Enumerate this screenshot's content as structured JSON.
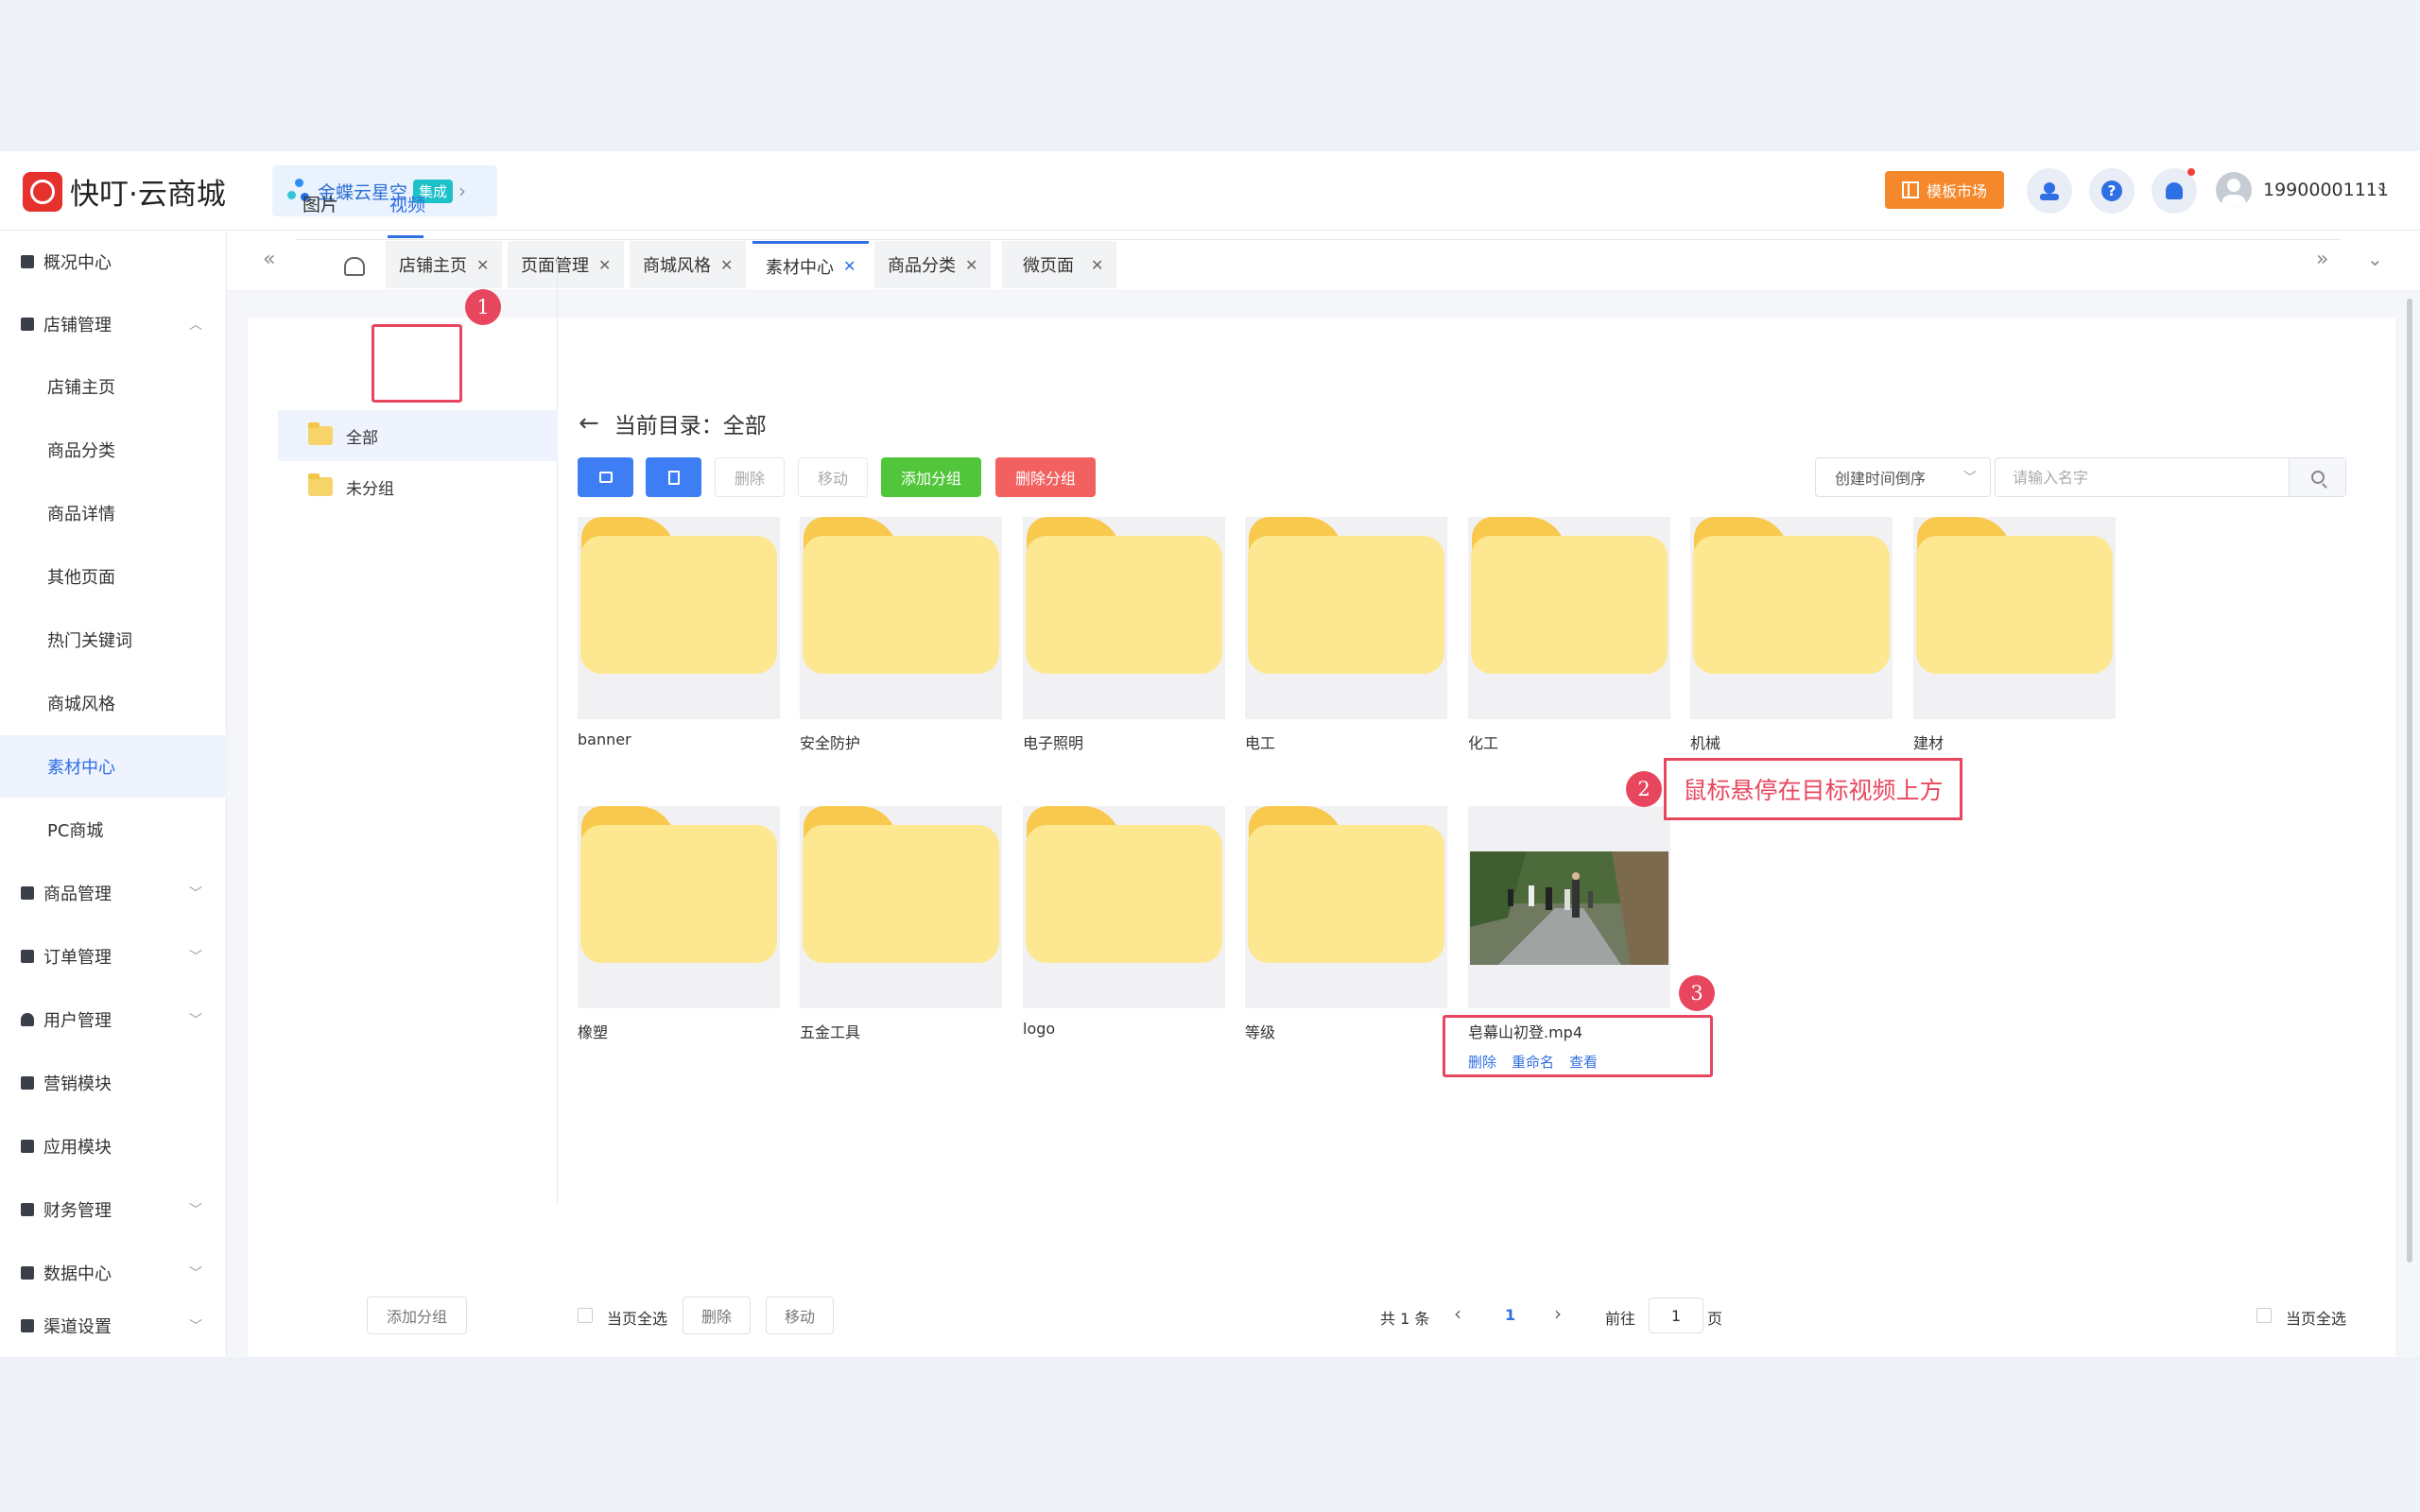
{
  "header": {
    "brand": "快叮·云商城",
    "integration": {
      "name": "金蝶云星空",
      "tag": "集成"
    },
    "template_market": "模板市场",
    "username": "19900001111"
  },
  "sidebar": {
    "items": [
      {
        "label": "概况中心"
      },
      {
        "label": "店铺管理"
      },
      {
        "label": "店铺主页"
      },
      {
        "label": "商品分类"
      },
      {
        "label": "商品详情"
      },
      {
        "label": "其他页面"
      },
      {
        "label": "热门关键词"
      },
      {
        "label": "商城风格"
      },
      {
        "label": "素材中心"
      },
      {
        "label": "PC商城"
      },
      {
        "label": "商品管理"
      },
      {
        "label": "订单管理"
      },
      {
        "label": "用户管理"
      },
      {
        "label": "营销模块"
      },
      {
        "label": "应用模块"
      },
      {
        "label": "财务管理"
      },
      {
        "label": "数据中心"
      },
      {
        "label": "渠道设置"
      }
    ]
  },
  "tabs": [
    {
      "label": "店铺主页"
    },
    {
      "label": "页面管理"
    },
    {
      "label": "商城风格"
    },
    {
      "label": "素材中心"
    },
    {
      "label": "商品分类"
    },
    {
      "label": "微页面"
    }
  ],
  "media_tabs": {
    "images": "图片",
    "videos": "视频"
  },
  "groups": [
    {
      "label": "全部"
    },
    {
      "label": "未分组"
    }
  ],
  "add_group_left": "添加分组",
  "breadcrumb": "当前目录：全部",
  "toolbar": {
    "delete": "删除",
    "move": "移动",
    "add_group": "添加分组",
    "delete_group": "删除分组",
    "sort": "创建时间倒序",
    "search_placeholder": "请输入名字"
  },
  "folders": [
    {
      "name": "banner"
    },
    {
      "name": "安全防护"
    },
    {
      "name": "电子照明"
    },
    {
      "name": "电工"
    },
    {
      "name": "化工"
    },
    {
      "name": "机械"
    },
    {
      "name": "建材"
    },
    {
      "name": "橡塑"
    },
    {
      "name": "五金工具"
    },
    {
      "name": "logo"
    },
    {
      "name": "等级"
    }
  ],
  "video": {
    "name": "皂幕山初登.mp4",
    "actions": {
      "delete": "删除",
      "rename": "重命名",
      "view": "查看"
    }
  },
  "annotations": {
    "n1": "1",
    "n2": "2",
    "n3": "3",
    "hint": "鼠标悬停在目标视频上方"
  },
  "footer": {
    "select_page": "当页全选",
    "delete": "删除",
    "move": "移动",
    "total": "共 1 条",
    "current_page": "1",
    "goto": "前往",
    "goto_value": "1",
    "page_unit": "页",
    "select_page_right": "当页全选"
  },
  "colors": {
    "primary": "#2f6fe4",
    "green": "#52c63b",
    "red": "#f26060",
    "orange": "#f4882a",
    "annotation": "#e8465e",
    "folder": "#fde891"
  }
}
